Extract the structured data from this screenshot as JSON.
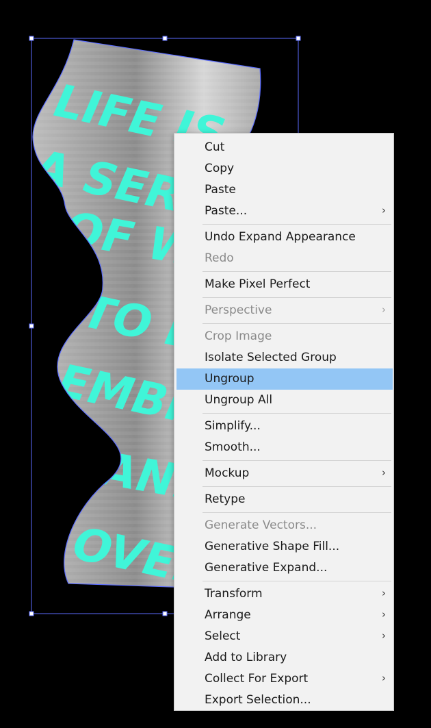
{
  "artwork": {
    "lines": [
      "LIFE IS",
      "A SERIES",
      "OF WAVES",
      "TO BE",
      "EMBRACED",
      "AND",
      "OVERCOME"
    ],
    "text_color": "#40f5d8",
    "ribbon_light": "#d6d6d6",
    "ribbon_dark": "#8c8c8c",
    "selection_color": "#5b6cff"
  },
  "context_menu": {
    "highlight_color": "#93c6f5",
    "items": [
      {
        "label": "Cut",
        "enabled": true,
        "submenu": false
      },
      {
        "label": "Copy",
        "enabled": true,
        "submenu": false
      },
      {
        "label": "Paste",
        "enabled": true,
        "submenu": false
      },
      {
        "label": "Paste...",
        "enabled": true,
        "submenu": true
      },
      {
        "label": "Undo Expand Appearance",
        "enabled": true,
        "submenu": false
      },
      {
        "label": "Redo",
        "enabled": false,
        "submenu": false
      },
      {
        "label": "Make Pixel Perfect",
        "enabled": true,
        "submenu": false
      },
      {
        "label": "Perspective",
        "enabled": false,
        "submenu": true
      },
      {
        "label": "Crop Image",
        "enabled": false,
        "submenu": false
      },
      {
        "label": "Isolate Selected Group",
        "enabled": true,
        "submenu": false
      },
      {
        "label": "Ungroup",
        "enabled": true,
        "submenu": false,
        "highlighted": true
      },
      {
        "label": "Ungroup All",
        "enabled": true,
        "submenu": false
      },
      {
        "label": "Simplify...",
        "enabled": true,
        "submenu": false
      },
      {
        "label": "Smooth...",
        "enabled": true,
        "submenu": false
      },
      {
        "label": "Mockup",
        "enabled": true,
        "submenu": true
      },
      {
        "label": "Retype",
        "enabled": true,
        "submenu": false
      },
      {
        "label": "Generate Vectors...",
        "enabled": false,
        "submenu": false
      },
      {
        "label": "Generative Shape Fill...",
        "enabled": true,
        "submenu": false
      },
      {
        "label": "Generative Expand...",
        "enabled": true,
        "submenu": false
      },
      {
        "label": "Transform",
        "enabled": true,
        "submenu": true
      },
      {
        "label": "Arrange",
        "enabled": true,
        "submenu": true
      },
      {
        "label": "Select",
        "enabled": true,
        "submenu": true
      },
      {
        "label": "Add to Library",
        "enabled": true,
        "submenu": false
      },
      {
        "label": "Collect For Export",
        "enabled": true,
        "submenu": true
      },
      {
        "label": "Export Selection...",
        "enabled": true,
        "submenu": false
      }
    ],
    "icons": {
      "submenu": "chevron-right-icon"
    }
  }
}
